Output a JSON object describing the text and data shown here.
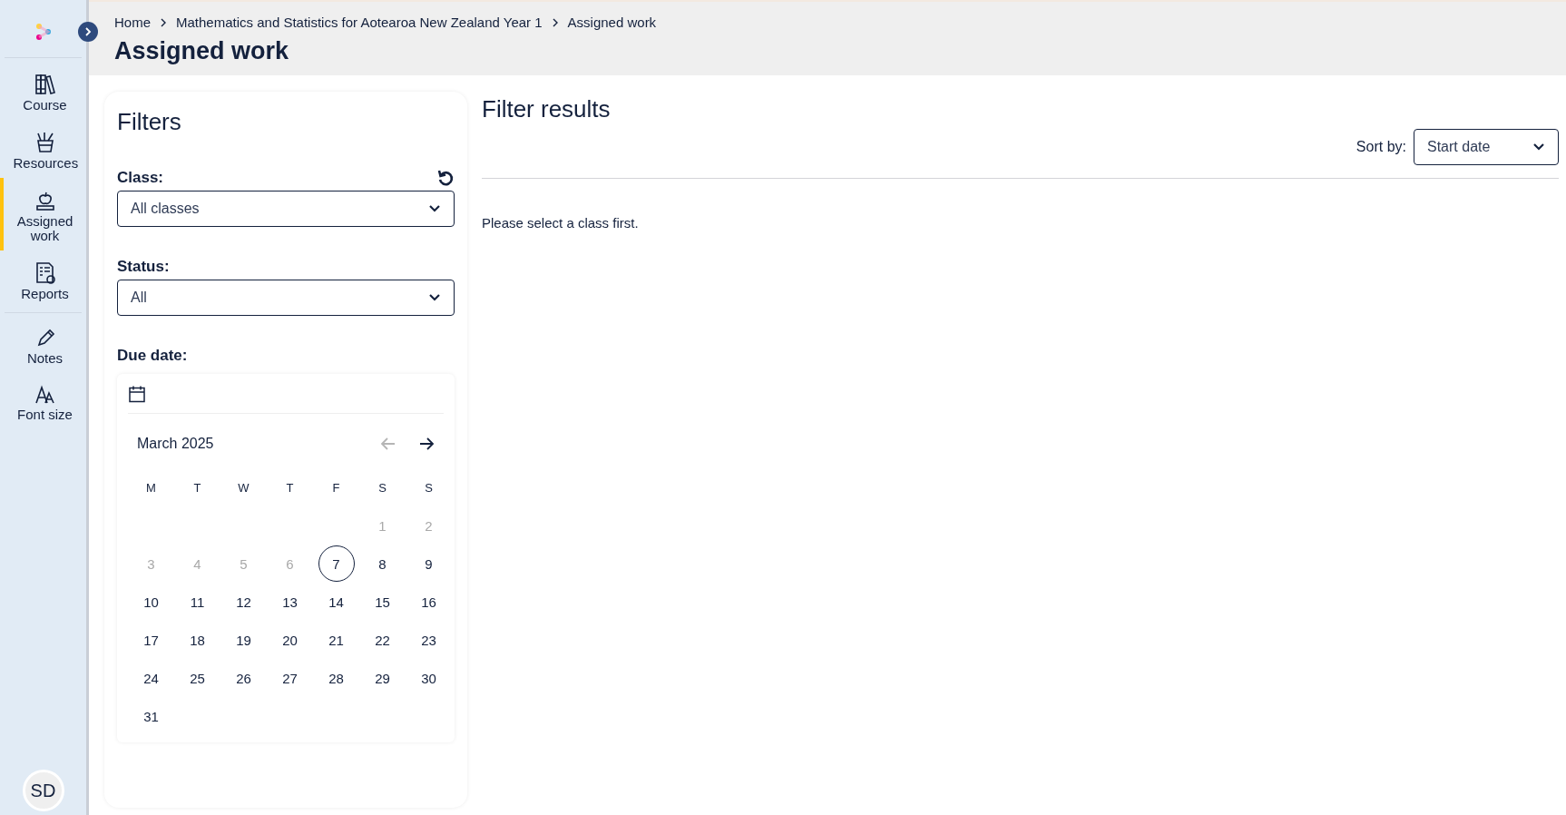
{
  "sidebar": {
    "items": [
      {
        "label": "Course",
        "selected": false
      },
      {
        "label": "Resources",
        "selected": false
      },
      {
        "label": "Assigned work",
        "selected": true
      },
      {
        "label": "Reports",
        "selected": false
      }
    ],
    "tools": [
      {
        "label": "Notes"
      },
      {
        "label": "Font size"
      }
    ],
    "avatar": "SD"
  },
  "breadcrumb": [
    "Home",
    "Mathematics and Statistics for Aotearoa New Zealand Year 1",
    "Assigned work"
  ],
  "page_title": "Assigned work",
  "filters": {
    "title": "Filters",
    "fields": [
      {
        "label": "Class:",
        "value": "All classes",
        "reset": true
      },
      {
        "label": "Status:",
        "value": "All",
        "reset": false
      }
    ],
    "due_date": {
      "label": "Due date:",
      "month": "March 2025",
      "prev_disabled": true,
      "next_disabled": false,
      "weekdays": [
        "M",
        "T",
        "W",
        "T",
        "F",
        "S",
        "S"
      ],
      "weeks": [
        [
          {
            "day": "1",
            "disabled": true,
            "selected": false
          },
          {
            "day": "2",
            "disabled": true,
            "selected": false
          }
        ],
        [
          {
            "day": "3",
            "disabled": true,
            "selected": false
          },
          {
            "day": "4",
            "disabled": true,
            "selected": false
          },
          {
            "day": "5",
            "disabled": true,
            "selected": false
          },
          {
            "day": "6",
            "disabled": true,
            "selected": false
          },
          {
            "day": "7",
            "disabled": false,
            "selected": true
          },
          {
            "day": "8",
            "disabled": false,
            "selected": false
          },
          {
            "day": "9",
            "disabled": false,
            "selected": false
          }
        ],
        [
          {
            "day": "10",
            "disabled": false,
            "selected": false
          },
          {
            "day": "11",
            "disabled": false,
            "selected": false
          },
          {
            "day": "12",
            "disabled": false,
            "selected": false
          },
          {
            "day": "13",
            "disabled": false,
            "selected": false
          },
          {
            "day": "14",
            "disabled": false,
            "selected": false
          },
          {
            "day": "15",
            "disabled": false,
            "selected": false
          },
          {
            "day": "16",
            "disabled": false,
            "selected": false
          }
        ],
        [
          {
            "day": "17",
            "disabled": false,
            "selected": false
          },
          {
            "day": "18",
            "disabled": false,
            "selected": false
          },
          {
            "day": "19",
            "disabled": false,
            "selected": false
          },
          {
            "day": "20",
            "disabled": false,
            "selected": false
          },
          {
            "day": "21",
            "disabled": false,
            "selected": false
          },
          {
            "day": "22",
            "disabled": false,
            "selected": false
          },
          {
            "day": "23",
            "disabled": false,
            "selected": false
          }
        ],
        [
          {
            "day": "24",
            "disabled": false,
            "selected": false
          },
          {
            "day": "25",
            "disabled": false,
            "selected": false
          },
          {
            "day": "26",
            "disabled": false,
            "selected": false
          },
          {
            "day": "27",
            "disabled": false,
            "selected": false
          },
          {
            "day": "28",
            "disabled": false,
            "selected": false
          },
          {
            "day": "29",
            "disabled": false,
            "selected": false
          },
          {
            "day": "30",
            "disabled": false,
            "selected": false
          }
        ],
        [
          {
            "day": "31",
            "disabled": false,
            "selected": false
          }
        ]
      ]
    }
  },
  "results": {
    "title": "Filter results",
    "sort_label": "Sort by:",
    "sort_value": "Start date",
    "message": "Please select a class first."
  }
}
